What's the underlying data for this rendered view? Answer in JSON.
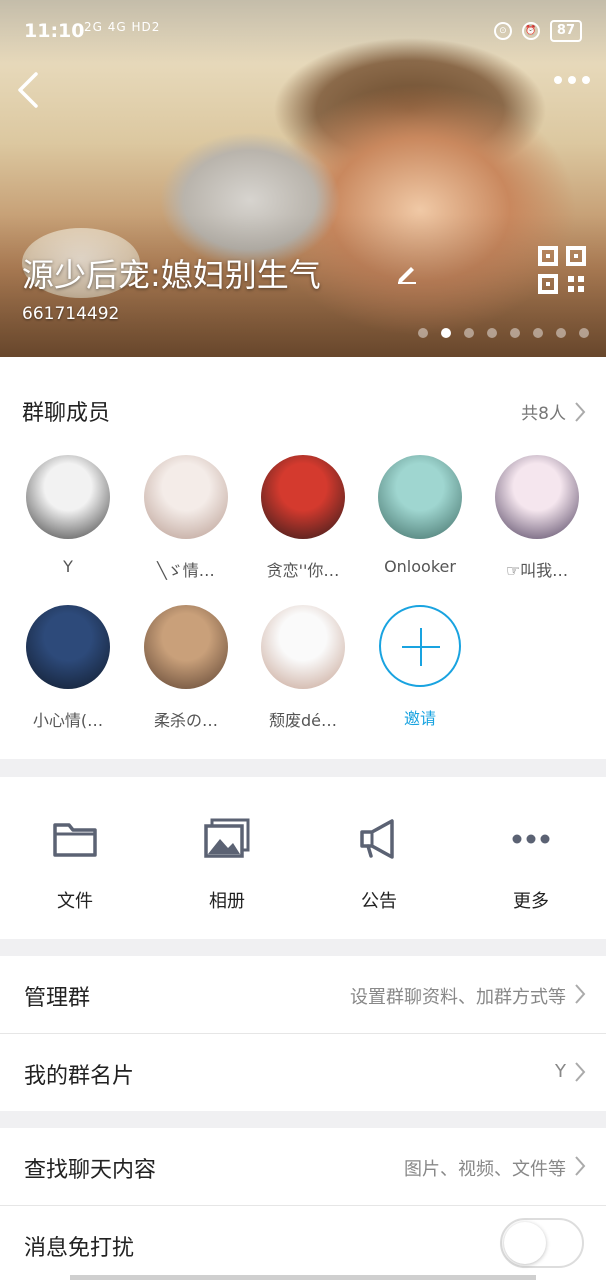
{
  "status_bar": {
    "time": "11:10",
    "signals": "2G 4G HD2",
    "battery": "87"
  },
  "header": {
    "group_name": "源少后宠:媳妇别生气",
    "group_id": "661714492",
    "page_dots": 8,
    "active_dot": 2,
    "icons": [
      "back-icon",
      "more-icon",
      "edit-icon",
      "qr-code-icon"
    ]
  },
  "members": {
    "title": "群聊成员",
    "count": "共8人",
    "list": [
      {
        "name": "Y",
        "color1": "#f2f2f2",
        "color2": "#3a3a3a"
      },
      {
        "name": "╲ゞ情…",
        "color1": "#f4ece8",
        "color2": "#b79a8f"
      },
      {
        "name": "贪恋''你…",
        "color1": "#d43a2e",
        "color2": "#2a1a1a"
      },
      {
        "name": "Onlooker",
        "color1": "#9fd6d0",
        "color2": "#3e6a63"
      },
      {
        "name": "☞叫我…",
        "color1": "#f5e6ee",
        "color2": "#4a3b5a"
      },
      {
        "name": "小心情(…",
        "color1": "#2d4a7a",
        "color2": "#101a2a"
      },
      {
        "name": "柔杀の…",
        "color1": "#c9a07a",
        "color2": "#5a4030"
      },
      {
        "name": "颓废dé…",
        "color1": "#fafafa",
        "color2": "#c4a090"
      }
    ],
    "invite_label": "邀请"
  },
  "functions": [
    {
      "label": "文件",
      "icon": "folder-icon"
    },
    {
      "label": "相册",
      "icon": "album-icon"
    },
    {
      "label": "公告",
      "icon": "megaphone-icon"
    },
    {
      "label": "更多",
      "icon": "more-dots-icon"
    }
  ],
  "rows": {
    "manage": {
      "label": "管理群",
      "value": "设置群聊资料、加群方式等"
    },
    "card": {
      "label": "我的群名片",
      "value": "Y"
    },
    "search": {
      "label": "查找聊天内容",
      "value": "图片、视频、文件等"
    },
    "mute": {
      "label": "消息免打扰",
      "enabled": false
    }
  },
  "colors": {
    "accent": "#19a3e0",
    "icon_gray": "#5b6273",
    "background": "#f0f0f2"
  }
}
